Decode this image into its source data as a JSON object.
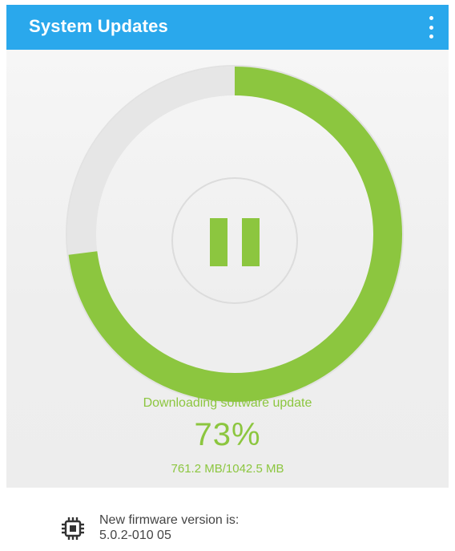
{
  "app_bar": {
    "title": "System Updates",
    "background": "#2aa8ec",
    "overflow_icon": "more-vert-icon"
  },
  "download": {
    "status_label": "Downloading software update",
    "progress_text": "73%",
    "progress_fraction": 0.73,
    "size_text": "761.2 MB/1042.5 MB",
    "accent_color": "#8cc63f",
    "track_color": "#e6e6e6",
    "pause_icon": "pause-icon"
  },
  "firmware": {
    "label": "New firmware version is:",
    "version": "5.0.2-010 05",
    "icon": "chip-icon"
  }
}
